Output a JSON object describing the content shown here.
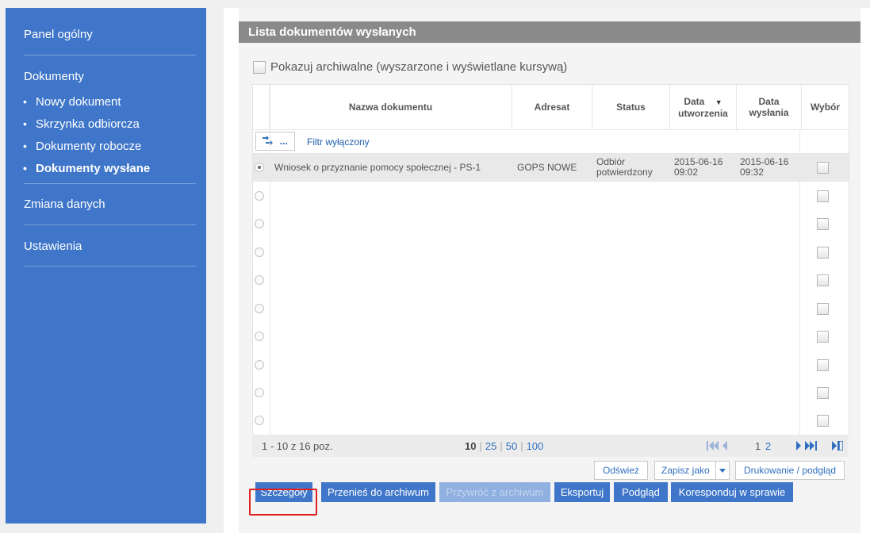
{
  "sidebar": {
    "panel": "Panel ogólny",
    "dokumenty": "Dokumenty",
    "items": [
      {
        "label": "Nowy dokument"
      },
      {
        "label": "Skrzynka odbiorcza"
      },
      {
        "label": "Dokumenty robocze"
      },
      {
        "label": "Dokumenty wysłane",
        "active": true
      }
    ],
    "zmiana": "Zmiana danych",
    "ustawienia": "Ustawienia",
    "bullet": "•"
  },
  "list": {
    "title": "Lista dokumentów wysłanych",
    "archive_label": "Pokazuj archiwalne (wyszarzone i wyświetlane kursywą)",
    "columns": {
      "nazwa": "Nazwa dokumentu",
      "adresat": "Adresat",
      "status": "Status",
      "data_utw_1": "Data",
      "data_utw_2": "utworzenia",
      "sort_arrow": "▼",
      "data_wys_1": "Data",
      "data_wys_2": "wysłania",
      "wybor": "Wybór"
    },
    "filter_button": "...",
    "filter_label": "Filtr wyłączony",
    "rows": [
      {
        "nazwa": "Wniosek o przyznanie pomocy społecznej - PS-1",
        "adresat": "GOPS NOWE",
        "status_1": "Odbiór",
        "status_2": "potwierdzony",
        "utw_1": "2015-06-16",
        "utw_2": "09:02",
        "wys_1": "2015-06-16",
        "wys_2": "09:32"
      }
    ]
  },
  "pager": {
    "range": "1 - 10 z 16 poz.",
    "sizes": [
      "10",
      "25",
      "50",
      "100"
    ],
    "pages": [
      "1",
      "2"
    ]
  },
  "actions": {
    "odswiez": "Odśwież",
    "zapisz": "Zapisz jako",
    "drukowanie": "Drukowanie / podgląd"
  },
  "buttons": {
    "szczegoly": "Szczegóły",
    "przenies": "Przenieś do archiwum",
    "przywroc": "Przywróć z archiwum",
    "eksportuj": "Eksportuj",
    "podglad": "Podgląd",
    "koresponduj": "Koresponduj w sprawie"
  },
  "colors": {
    "sidebar": "#3f76c9",
    "header": "#8a8a8a",
    "highlight": "#e02020"
  }
}
